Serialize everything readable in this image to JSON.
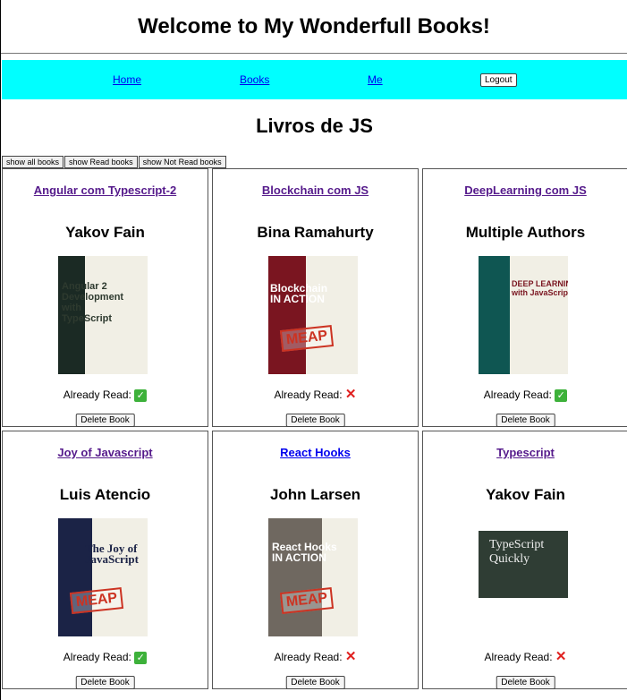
{
  "header": {
    "title": "Welcome to My Wonderfull Books!"
  },
  "nav": {
    "home": "Home",
    "books": "Books",
    "me": "Me",
    "logout": "Logout",
    "bg_color": "#00ffff"
  },
  "section": {
    "title": "Livros de JS"
  },
  "filters": {
    "all": "show all books",
    "read": "show Read books",
    "not_read": "show Not Read books"
  },
  "labels": {
    "already_read": "Already Read:",
    "delete": "Delete Book",
    "read_yes": "✅",
    "read_no": "❌"
  },
  "books": [
    {
      "title": "Angular com Typescript-2",
      "author": "Yakov Fain",
      "read": true,
      "cover": {
        "lines": "Angular 2\nDevelopment\nwith TypeScript",
        "spine": "#1b2a24",
        "art": "#f1efe5",
        "meap": false
      }
    },
    {
      "title": "Blockchain com JS",
      "author": "Bina Ramahurty",
      "read": false,
      "cover": {
        "lines": "Blockchain\nIN ACTION",
        "spine": "#7a1520",
        "art": "#f1efe5",
        "meap": true,
        "meap_text": "MEAP"
      }
    },
    {
      "title": "DeepLearning com JS",
      "author": "Multiple Authors",
      "read": true,
      "cover": {
        "lines": "DEEP LEARNING\nwith JavaScript",
        "spine": "#0f5652",
        "art": "#f1efe5",
        "meap": false
      }
    },
    {
      "title": "Joy of Javascript",
      "author": "Luis Atencio",
      "read": true,
      "cover": {
        "lines": "The Joy of\nJavaScript",
        "spine": "#1b2346",
        "art": "#f1efe5",
        "meap": true,
        "meap_text": "MEAP"
      }
    },
    {
      "title": "React Hooks",
      "author": "John Larsen",
      "read": false,
      "cover": {
        "lines": "React Hooks\nIN ACTION",
        "spine": "#6f6860",
        "art": "#f1efe5",
        "meap": true,
        "meap_text": "MEAP"
      }
    },
    {
      "title": "Typescript",
      "author": "Yakov Fain",
      "read": false,
      "cover": {
        "lines": "TypeScript\nQuickly",
        "spine": "#2f3d34",
        "art": "#ffffff",
        "meap": false
      }
    }
  ]
}
